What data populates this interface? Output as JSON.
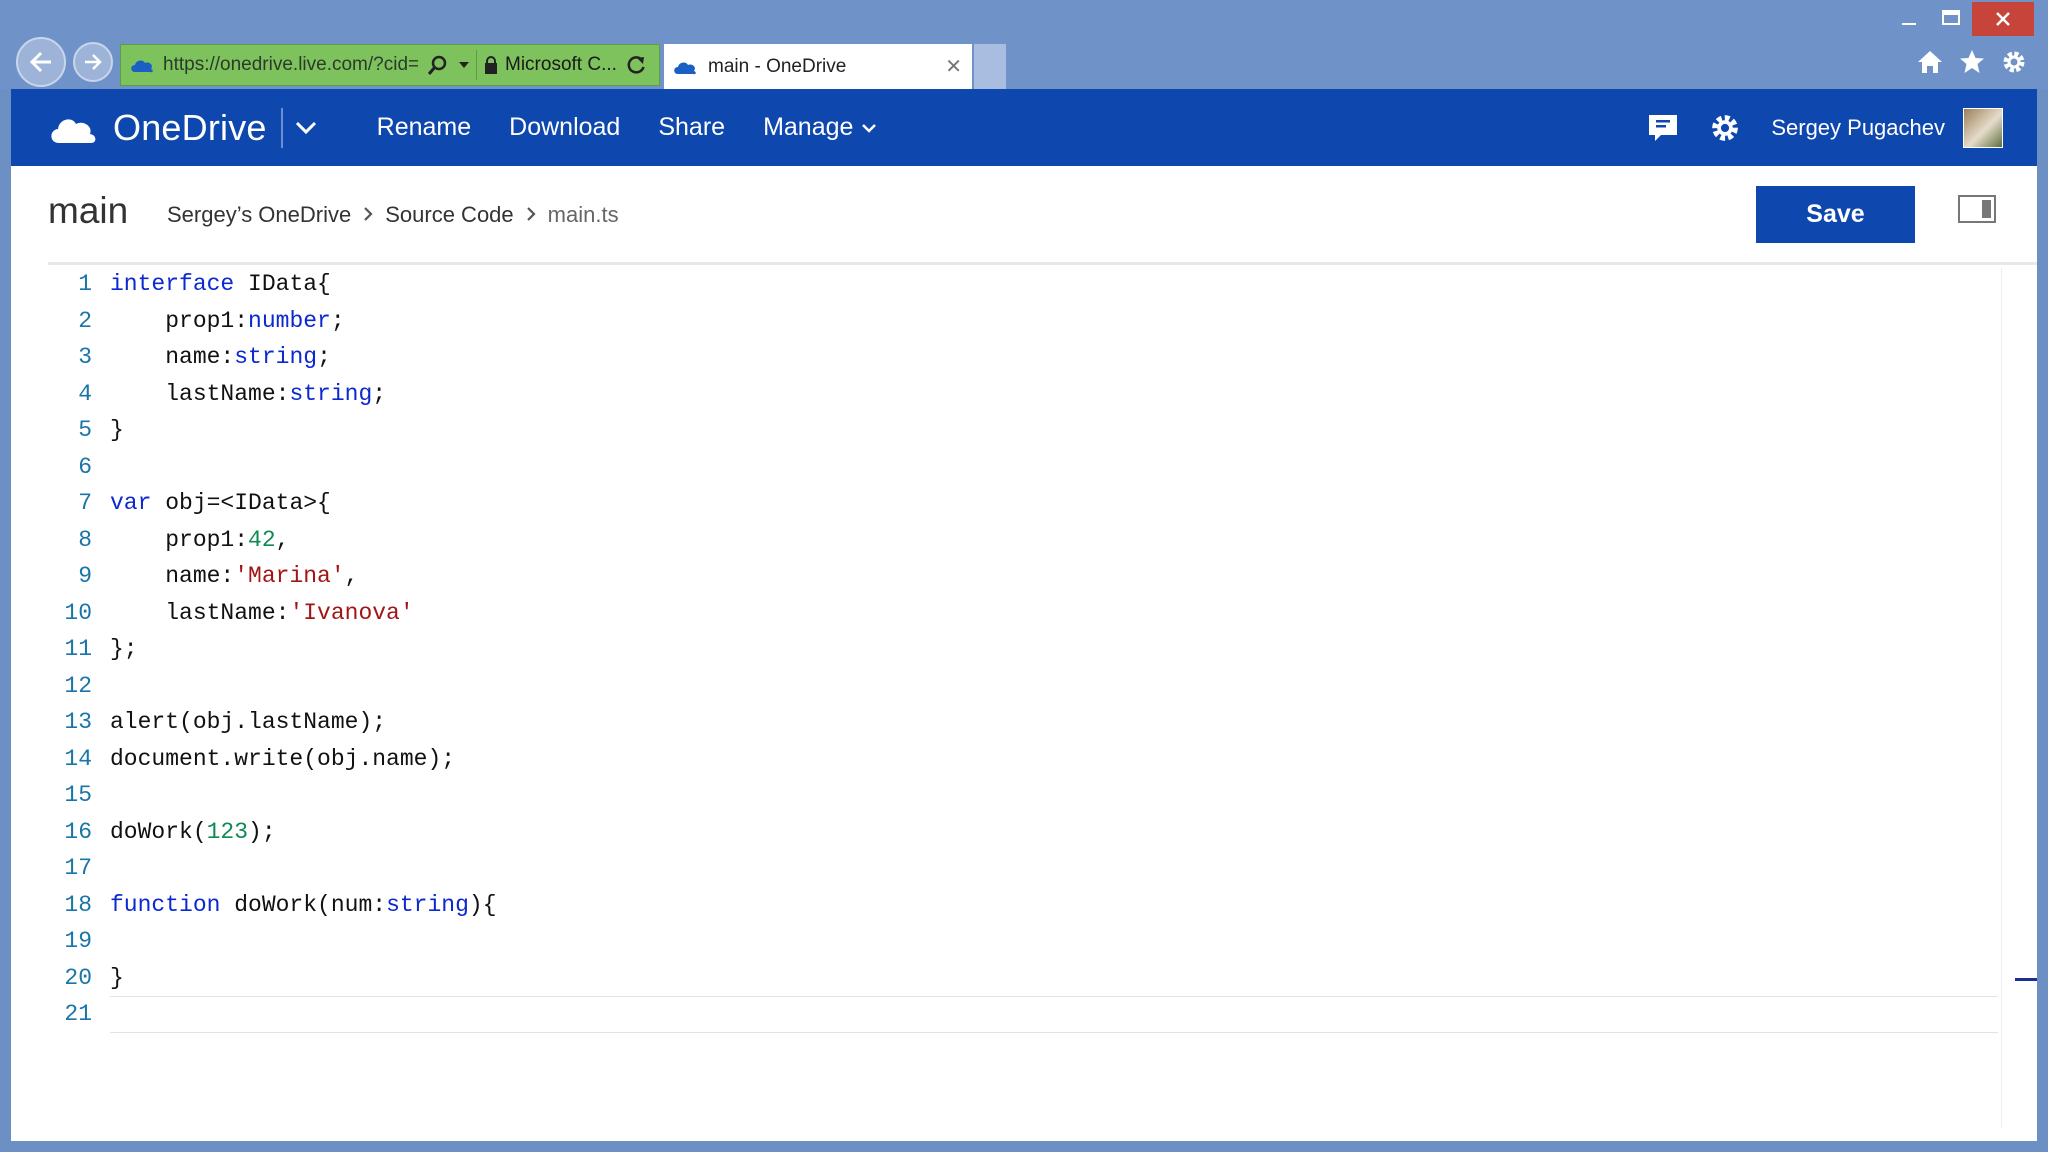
{
  "browser": {
    "address_url": "https://onedrive.live.com/?cid=",
    "certificate_label": "Microsoft C...",
    "tab_title": "main - OneDrive",
    "tab_close_glyph": "✕"
  },
  "app": {
    "brand": "OneDrive",
    "commands": {
      "rename": "Rename",
      "download": "Download",
      "share": "Share",
      "manage": "Manage"
    },
    "user_name": "Sergey Pugachev"
  },
  "page": {
    "title": "main",
    "breadcrumb": [
      "Sergey’s OneDrive",
      "Source Code",
      "main.ts"
    ],
    "save_label": "Save"
  },
  "editor": {
    "current_line": 21,
    "lines": [
      [
        {
          "t": "interface",
          "c": "kw"
        },
        {
          "t": " IData{"
        }
      ],
      [
        {
          "t": "    prop1:"
        },
        {
          "t": "number",
          "c": "kw"
        },
        {
          "t": ";"
        }
      ],
      [
        {
          "t": "    name:"
        },
        {
          "t": "string",
          "c": "kw"
        },
        {
          "t": ";"
        }
      ],
      [
        {
          "t": "    lastName:"
        },
        {
          "t": "string",
          "c": "kw"
        },
        {
          "t": ";"
        }
      ],
      [
        {
          "t": "}"
        }
      ],
      [],
      [
        {
          "t": "var",
          "c": "kw"
        },
        {
          "t": " obj=<IData>{"
        }
      ],
      [
        {
          "t": "    prop1:"
        },
        {
          "t": "42",
          "c": "num"
        },
        {
          "t": ","
        }
      ],
      [
        {
          "t": "    name:"
        },
        {
          "t": "'Marina'",
          "c": "str"
        },
        {
          "t": ","
        }
      ],
      [
        {
          "t": "    lastName:"
        },
        {
          "t": "'Ivanova'",
          "c": "str"
        }
      ],
      [
        {
          "t": "};"
        }
      ],
      [],
      [
        {
          "t": "alert(obj.lastName);"
        }
      ],
      [
        {
          "t": "document.write(obj.name);"
        }
      ],
      [],
      [
        {
          "t": "doWork("
        },
        {
          "t": "123",
          "c": "num"
        },
        {
          "t": ");"
        }
      ],
      [],
      [
        {
          "t": "function",
          "c": "kw"
        },
        {
          "t": " doWork(num:"
        },
        {
          "t": "string",
          "c": "kw"
        },
        {
          "t": "){"
        }
      ],
      [],
      [
        {
          "t": "}"
        }
      ],
      []
    ]
  },
  "colors": {
    "app_bar": "#0e47ae",
    "address_bar_secure": "#7ec25e",
    "keyword": "#0b28d1",
    "number": "#108a55",
    "string": "#a31515",
    "line_number": "#1a75a8"
  },
  "icons": {
    "back": "arrow-left-icon",
    "forward": "arrow-right-icon",
    "search": "search-icon",
    "lock": "lock-icon",
    "refresh": "refresh-icon",
    "home": "home-icon",
    "favorites": "star-icon",
    "tools": "gear-icon",
    "feedback": "feedback-icon",
    "settings": "gear-icon"
  }
}
